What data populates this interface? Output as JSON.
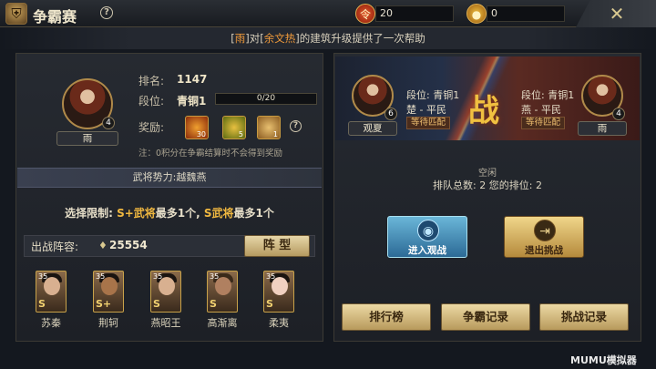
{
  "header": {
    "title": "争霸赛",
    "help_icon": "?",
    "resource1_value": "20",
    "resource2_value": "0",
    "close_icon": "✕"
  },
  "notice": {
    "prefix": "[",
    "player1": "雨",
    "mid1": "]对[",
    "player2": "余文热",
    "suffix": "]的建筑升级提供了一次帮助"
  },
  "player": {
    "name": "雨",
    "level": "4",
    "rank_label": "排名:",
    "rank_value": "1147",
    "tier_label": "段位:",
    "tier_value": "青铜1",
    "tier_progress": "0/20",
    "tier_progress_fraction": 0.0,
    "reward_label": "奖励:",
    "reward_counts": [
      "30",
      "5",
      "1"
    ],
    "reward_note": "注：0积分在争霸结算时不会得到奖励"
  },
  "faction": {
    "text": "武将势力:越魏燕"
  },
  "limit": {
    "prefix": "选择限制:",
    "s_plus": "S+武将",
    "mid": "最多1个,",
    "s": "S武将",
    "suffix": "最多1个"
  },
  "lineup": {
    "label": "出战阵容:",
    "power": "25554",
    "formation_button": "阵 型"
  },
  "heroes": [
    {
      "name": "苏秦",
      "level": "35",
      "grade": "S"
    },
    {
      "name": "荆轲",
      "level": "35",
      "grade": "S+"
    },
    {
      "name": "燕昭王",
      "level": "35",
      "grade": "S"
    },
    {
      "name": "高渐离",
      "level": "35",
      "grade": "S"
    },
    {
      "name": "柔夷",
      "level": "35",
      "grade": "S"
    }
  ],
  "battle": {
    "left_name": "观夏",
    "left_level": "6",
    "left_tier": "段位: 青铜1",
    "left_faction": "楚 - 平民",
    "left_tag": "等待匹配",
    "vs": "战",
    "right_name": "雨",
    "right_level": "4",
    "right_tier": "段位: 青铜1",
    "right_faction": "燕 - 平民",
    "right_tag": "等待匹配"
  },
  "queue": {
    "status": "空闲",
    "text": "排队总数: 2   您的排位: 2"
  },
  "actions": {
    "watch": "进入观战",
    "exit": "退出挑战",
    "rank_list": "排行榜",
    "record": "争霸记录",
    "challenge_record": "挑战记录"
  },
  "watermark": "MUMU模拟器"
}
